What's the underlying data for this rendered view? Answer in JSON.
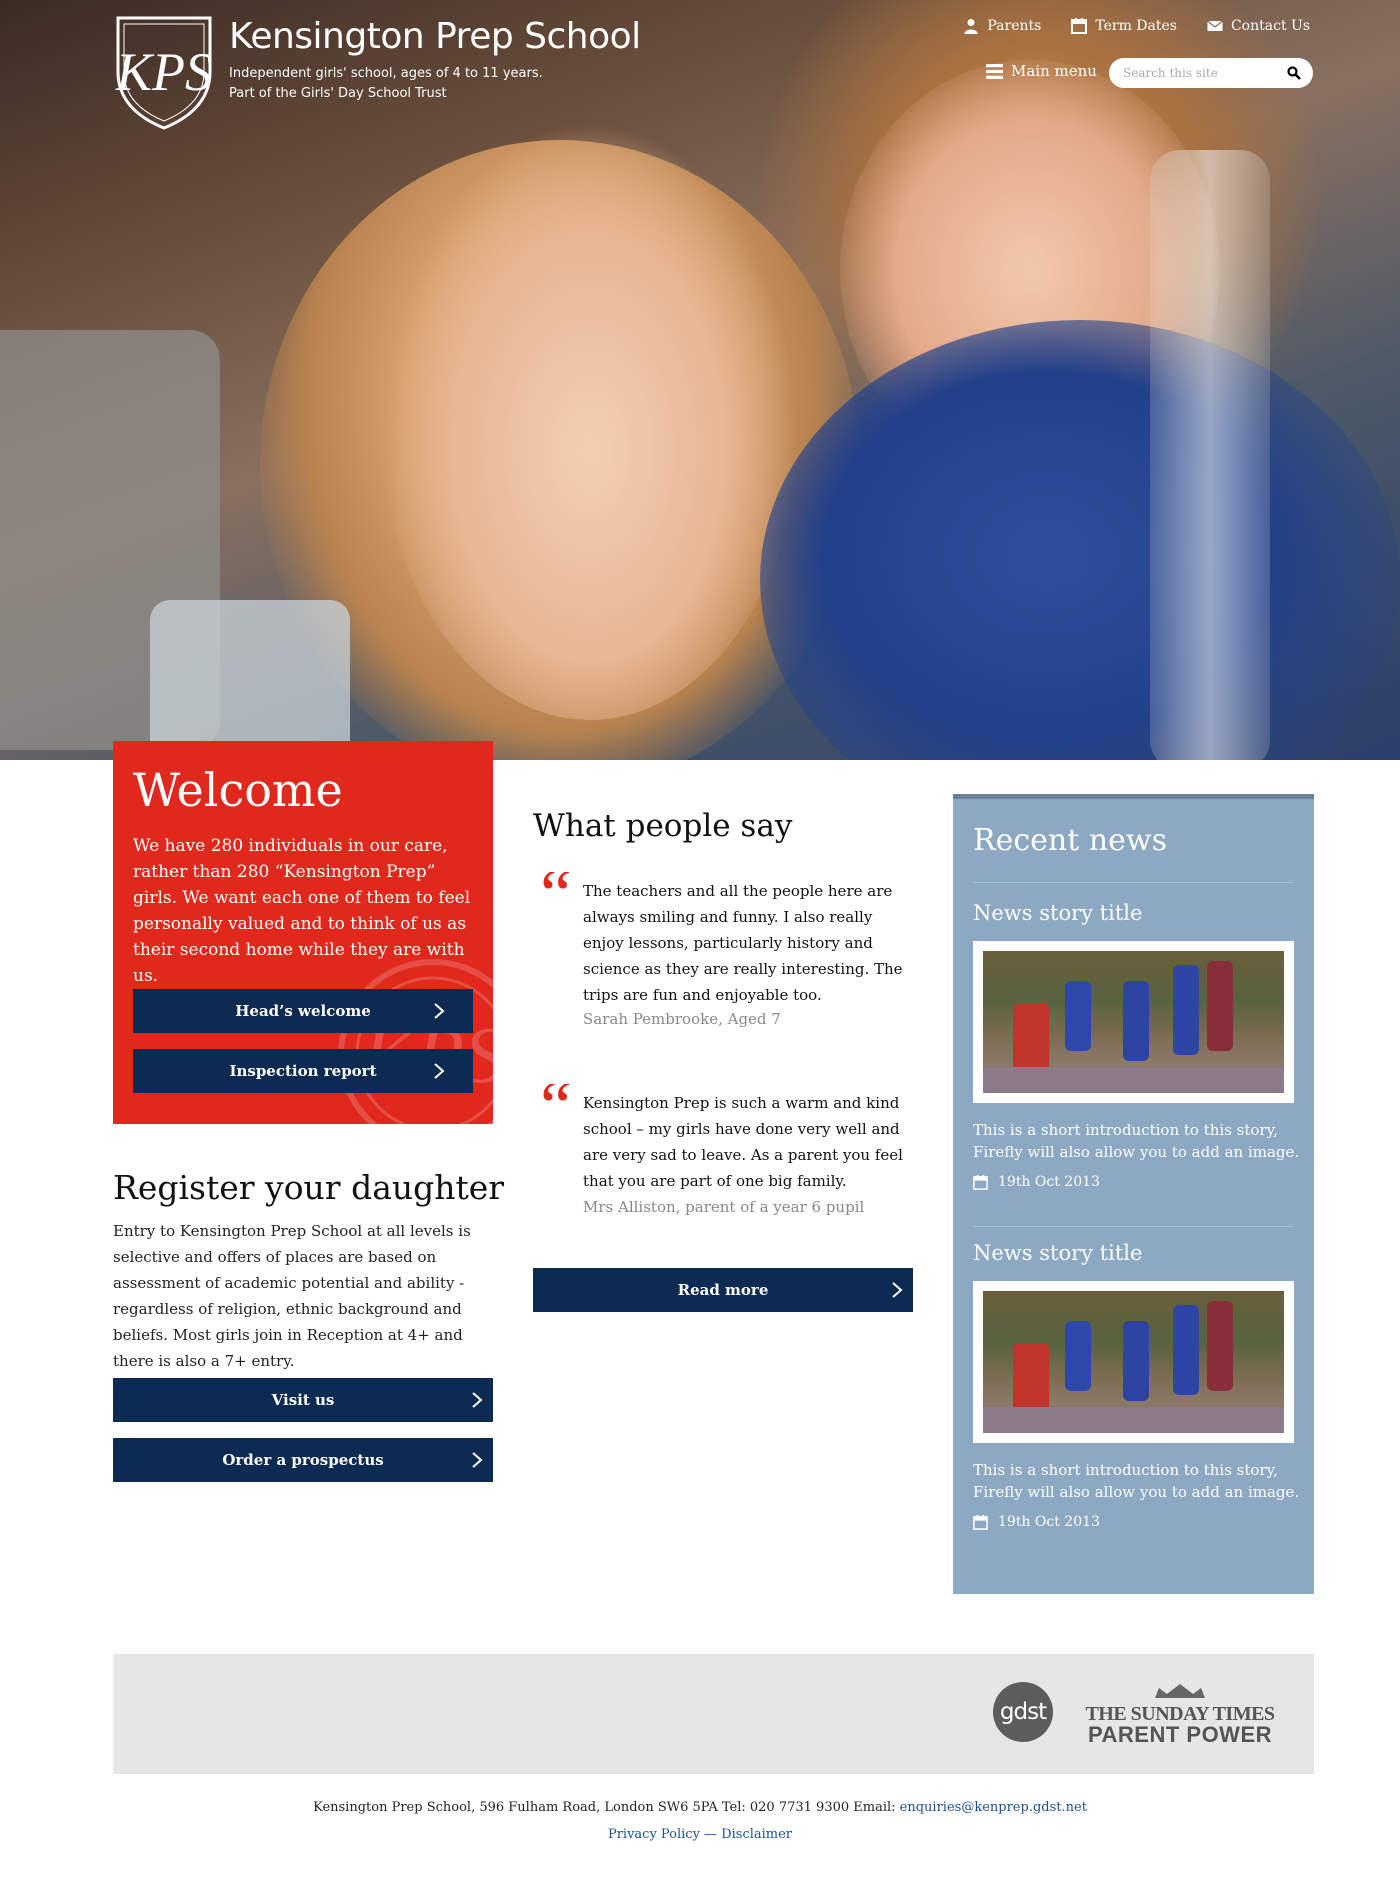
{
  "header": {
    "school_name": "Kensington Prep School",
    "subtitle_line1": "Independent girls' school, ages of 4 to 11 years.",
    "subtitle_line2": "Part of the Girls' Day School Trust",
    "logo_letters": "KPS",
    "utility_links": [
      {
        "label": "Parents",
        "icon": "person-icon"
      },
      {
        "label": "Term Dates",
        "icon": "calendar-icon"
      },
      {
        "label": "Contact Us",
        "icon": "envelope-icon"
      }
    ],
    "main_menu_label": "Main menu",
    "search_placeholder": "Search this site"
  },
  "welcome": {
    "title": "Welcome",
    "body": "We have 280 individuals in our care, rather than 280 “Kensington Prep” girls. We want each one of them to feel personally valued and to think of us as their second home while they are with us.",
    "buttons": [
      "Head’s welcome",
      "Inspection report"
    ]
  },
  "register": {
    "title": "Register your daughter",
    "body": "Entry to Kensington Prep School at all levels is selective and offers of places are based on assessment of academic potential and ability - regardless of religion, ethnic background and beliefs.  Most girls join in Reception at 4+ and there is also a 7+ entry.",
    "buttons": [
      "Visit us",
      "Order a prospectus"
    ]
  },
  "testimonials": {
    "title": "What people say",
    "quotes": [
      {
        "text": "The teachers and all the people here are always smiling and funny.  I also really enjoy lessons, particularly history and science as they are really interesting.  The trips are fun and enjoyable too.",
        "author": "Sarah Pembrooke, Aged 7"
      },
      {
        "text": "Kensington Prep is such a warm and kind school – my girls have done very well and are very sad to leave.  As a parent you feel that you are part of one big family.",
        "author": "Mrs Alliston, parent of a year 6 pupil"
      }
    ],
    "read_more": "Read more"
  },
  "news": {
    "title": "Recent news",
    "stories": [
      {
        "title": "News story title",
        "intro": "This is a short introduction to this story, Firefly will also allow you to add an image.",
        "date": "19th Oct 2013"
      },
      {
        "title": "News story title",
        "intro": "This is a short introduction to this story, Firefly will also allow you to add an image.",
        "date": "19th Oct 2013"
      }
    ]
  },
  "footer": {
    "gdst_logo": "gdst",
    "times_line1": "THE SUNDAY TIMES",
    "times_line2": "PARENT POWER",
    "address": "Kensington Prep School, 596 Fulham Road, London SW6 5PA  Tel: 020 7731 9300 Email: ",
    "email": "enquiries@kenprep.gdst.net",
    "privacy": "Privacy Policy",
    "separator": " — ",
    "disclaimer": "Disclaimer"
  },
  "colors": {
    "welcome_red": "#e0281d",
    "navy_button": "#0d2a52",
    "news_blue": "#8da8c3",
    "link_blue": "#1c4f8e"
  }
}
